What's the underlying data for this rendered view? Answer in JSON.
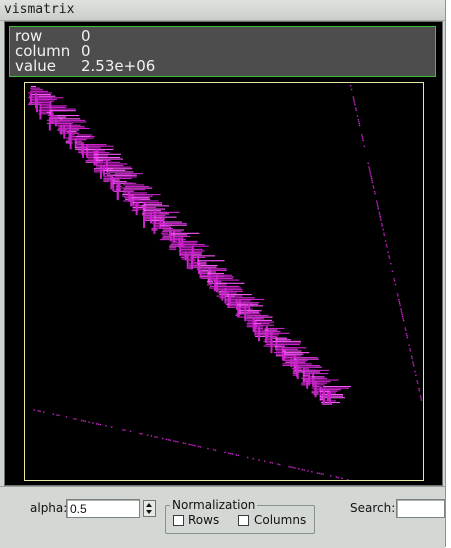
{
  "window": {
    "title": "vismatrix"
  },
  "info": {
    "row_label": "row",
    "row_value": "0",
    "column_label": "column",
    "column_value": "0",
    "value_label": "value",
    "value_value": "2.53e+06"
  },
  "controls": {
    "alpha_label": "alpha:",
    "alpha_value": "0.5",
    "normalization_label": "Normalization",
    "rows_label": "Rows",
    "rows_checked": false,
    "columns_label": "Columns",
    "columns_checked": false,
    "search_label": "Search:",
    "search_value": ""
  },
  "colors": {
    "matrix_entry": "#cc22cc",
    "matrix_bright": "#ff55ff",
    "frame": "#e8e8a0",
    "info_border": "#3fbf3f"
  }
}
